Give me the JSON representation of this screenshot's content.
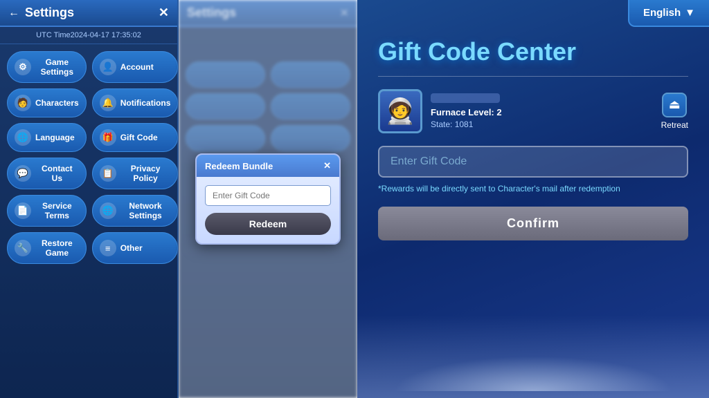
{
  "settings": {
    "title": "Settings",
    "close_label": "✕",
    "back_label": "←",
    "utc_time": "UTC Time2024-04-17 17:35:02",
    "buttons": [
      {
        "id": "game-settings",
        "label": "Game Settings",
        "icon": "⚙"
      },
      {
        "id": "account",
        "label": "Account",
        "icon": "👤"
      },
      {
        "id": "characters",
        "label": "Characters",
        "icon": "🧑"
      },
      {
        "id": "notifications",
        "label": "Notifications",
        "icon": "🔔"
      },
      {
        "id": "language",
        "label": "Language",
        "icon": "🌐"
      },
      {
        "id": "gift-code",
        "label": "Gift Code",
        "icon": "🎁"
      },
      {
        "id": "contact-us",
        "label": "Contact Us",
        "icon": "💬"
      },
      {
        "id": "privacy-policy",
        "label": "Privacy Policy",
        "icon": "📋"
      },
      {
        "id": "service-terms",
        "label": "Service Terms",
        "icon": "📄"
      },
      {
        "id": "network-settings",
        "label": "Network Settings",
        "icon": "🌐"
      },
      {
        "id": "restore-game",
        "label": "Restore Game",
        "icon": "🔧"
      },
      {
        "id": "other",
        "label": "Other",
        "icon": "≡"
      }
    ]
  },
  "redeem_dialog": {
    "title": "Redeem Bundle",
    "close_label": "✕",
    "input_placeholder": "Enter Gift Code",
    "redeem_button_label": "Redeem"
  },
  "gift_code_center": {
    "title": "Gift Code Center",
    "language_label": "English",
    "language_arrow": "▼",
    "user": {
      "username_placeholder": "████████",
      "furnace_level": "Furnace Level: 2",
      "state": "State: 1081"
    },
    "retreat_label": "Retreat",
    "input_placeholder": "Enter Gift Code",
    "reward_note": "*Rewards will be directly sent to Character's mail after redemption",
    "confirm_button_label": "Confirm"
  }
}
